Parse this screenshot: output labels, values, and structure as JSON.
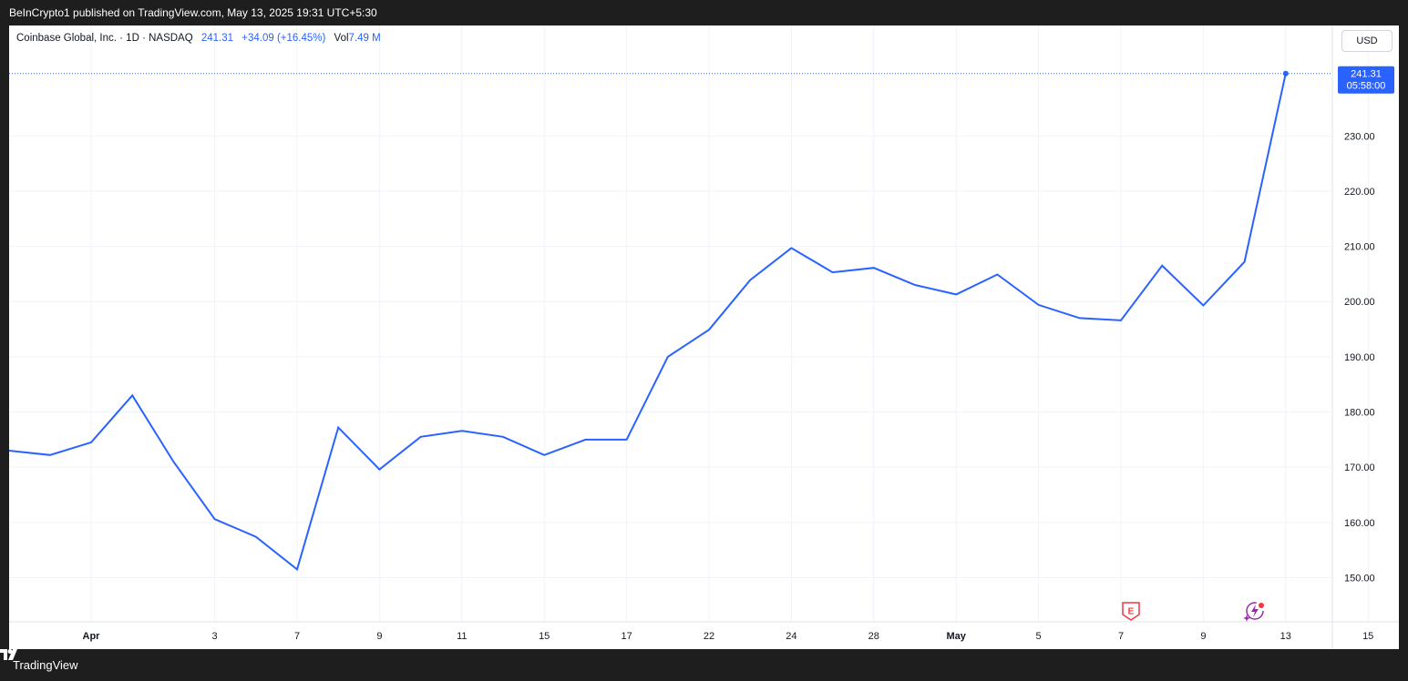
{
  "header": {
    "published": "BeInCrypto1 published on TradingView.com, May 13, 2025 19:31 UTC+5:30"
  },
  "legend": {
    "symbol": "Coinbase Global, Inc. · 1D · NASDAQ",
    "last": "241.31",
    "change": "+34.09 (+16.45%)",
    "vol_label": "Vol",
    "vol_value": "7.49 M"
  },
  "currency": "USD",
  "last_tag": {
    "price": "241.31",
    "countdown": "05:58:00"
  },
  "footer": {
    "brand": "TradingView"
  },
  "colors": {
    "line": "#2962ff",
    "grid": "#f0f3fa",
    "earnings": "#f23645",
    "dividend": "#9c27b0"
  },
  "icons": [
    "earnings-e-icon",
    "lightning-event-icon",
    "tradingview-logo-icon"
  ],
  "chart_data": {
    "type": "line",
    "ylim": [
      142,
      250
    ],
    "y_ticks": [
      150,
      160,
      170,
      180,
      190,
      200,
      210,
      220,
      230
    ],
    "x_ticks": [
      "Apr",
      "3",
      "7",
      "9",
      "11",
      "15",
      "17",
      "22",
      "24",
      "28",
      "May",
      "5",
      "7",
      "9",
      "13",
      "15"
    ],
    "x_tick_index": [
      2,
      5,
      7,
      9,
      11,
      13,
      15,
      17,
      19,
      21,
      23,
      25,
      27,
      29,
      31,
      33
    ],
    "series": [
      {
        "values": [
          173.0,
          172.2,
          174.5,
          183.0,
          171.0,
          160.6,
          157.4,
          151.5,
          177.2,
          169.6,
          175.5,
          176.6,
          175.5,
          172.2,
          175.0,
          175.0,
          190.0,
          194.9,
          203.9,
          209.7,
          205.3,
          206.1,
          203.0,
          201.3,
          204.9,
          199.4,
          197.0,
          196.6,
          206.5,
          199.3,
          207.2,
          241.31
        ]
      }
    ],
    "last_value": 241.31
  }
}
